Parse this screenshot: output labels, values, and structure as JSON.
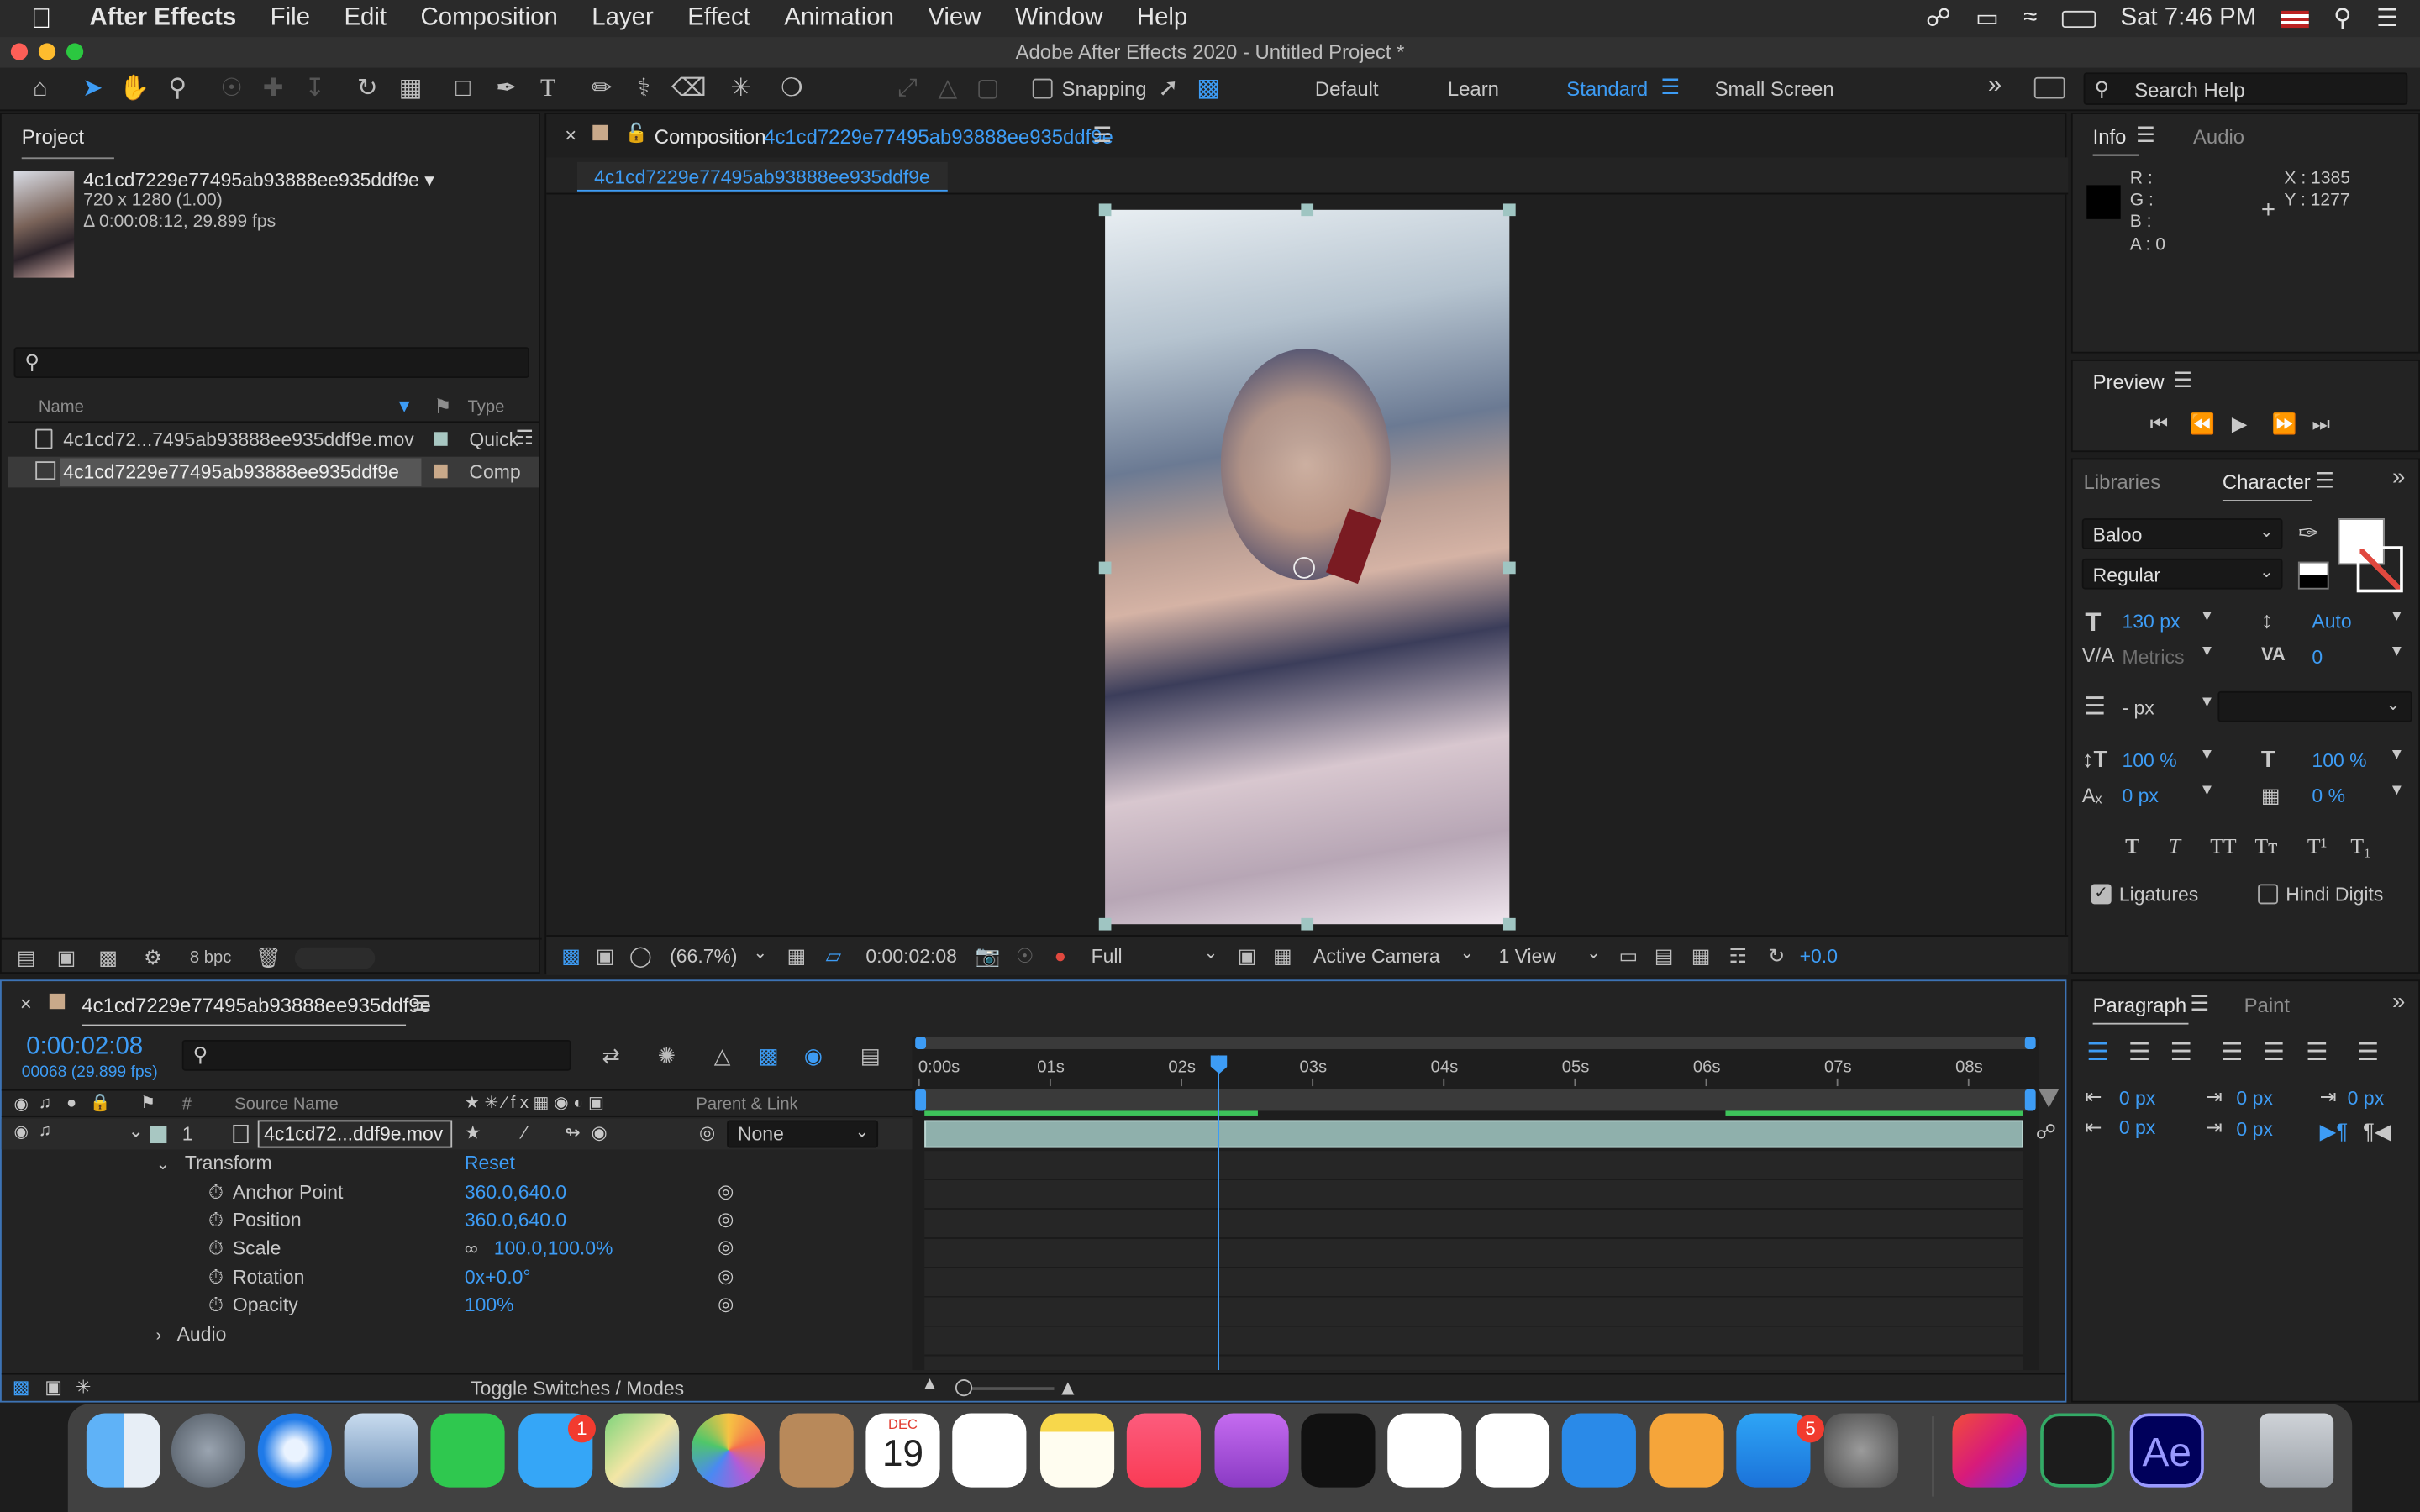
{
  "menubar": {
    "app": "After Effects",
    "items": [
      "File",
      "Edit",
      "Composition",
      "Layer",
      "Effect",
      "Animation",
      "View",
      "Window",
      "Help"
    ],
    "clock": "Sat 7:46 PM"
  },
  "window_title": "Adobe After Effects 2020 - Untitled Project *",
  "toolbar": {
    "snapping_label": "Snapping",
    "workspaces": [
      "Default",
      "Learn",
      "Standard",
      "Small Screen"
    ],
    "search_placeholder": "Search Help"
  },
  "project": {
    "title": "Project",
    "selected_name": "4c1cd7229e77495ab93888ee935ddf9e ▾",
    "dims": "720 x 1280 (1.00)",
    "duration": "Δ 0:00:08:12, 29.899 fps",
    "col_name": "Name",
    "col_type": "Type",
    "items": [
      {
        "name": "4c1cd72...7495ab93888ee935ddf9e.mov",
        "type": "Quick"
      },
      {
        "name": "4c1cd7229e77495ab93888ee935ddf9e",
        "type": "Comp"
      }
    ],
    "bpc": "8 bpc"
  },
  "composition": {
    "label": "Composition",
    "name": "4c1cd7229e77495ab93888ee935ddf9e",
    "tab": "4c1cd7229e77495ab93888ee935ddf9e",
    "zoom": "(66.7%)",
    "timecode": "0:00:02:08",
    "resolution": "Full",
    "camera": "Active Camera",
    "views": "1 View",
    "exposure": "+0.0"
  },
  "info": {
    "tab1": "Info",
    "tab2": "Audio",
    "r": "R :",
    "g": "G :",
    "b": "B :",
    "a": "A :  0",
    "x": "X : 1385",
    "y": "Y : 1277"
  },
  "preview": {
    "title": "Preview"
  },
  "character": {
    "tab1": "Libraries",
    "tab2": "Character",
    "font": "Baloo",
    "style": "Regular",
    "size": "130 px",
    "leading": "Auto",
    "kerning": "Metrics",
    "tracking": "0",
    "stroke": "- px",
    "vscale": "100 %",
    "hscale": "100 %",
    "baseline": "0 px",
    "tsume": "0 %",
    "styles": [
      "T",
      "T",
      "TT",
      "Tт",
      "T¹",
      "T₁"
    ],
    "ligatures": "Ligatures",
    "hindi": "Hindi Digits"
  },
  "paragraph": {
    "tab1": "Paragraph",
    "tab2": "Paint",
    "values": [
      "0 px",
      "0 px",
      "0 px",
      "0 px",
      "0 px"
    ]
  },
  "timeline": {
    "comp_name": "4c1cd7229e77495ab93888ee935ddf9e",
    "timecode": "0:00:02:08",
    "frames": "00068 (29.899 fps)",
    "col_num": "#",
    "col_source": "Source Name",
    "col_parent": "Parent & Link",
    "layer_num": "1",
    "layer_name": "4c1cd72...ddf9e.mov",
    "parent": "None",
    "transform": "Transform",
    "reset": "Reset",
    "props": [
      {
        "name": "Anchor Point",
        "value": "360.0,640.0"
      },
      {
        "name": "Position",
        "value": "360.0,640.0"
      },
      {
        "name": "Scale",
        "value": "100.0,100.0%"
      },
      {
        "name": "Rotation",
        "value": "0x+0.0°"
      },
      {
        "name": "Opacity",
        "value": "100%"
      }
    ],
    "audio": "Audio",
    "toggle": "Toggle Switches / Modes",
    "ruler": [
      "0:00s",
      "01s",
      "02s",
      "03s",
      "04s",
      "05s",
      "06s",
      "07s",
      "08s"
    ],
    "playhead_fraction": 0.27
  },
  "dock": {
    "calendar_month": "DEC",
    "calendar_day": "19",
    "badge_messages": "1",
    "badge_appstore": "5",
    "ae_label": "Ae"
  }
}
